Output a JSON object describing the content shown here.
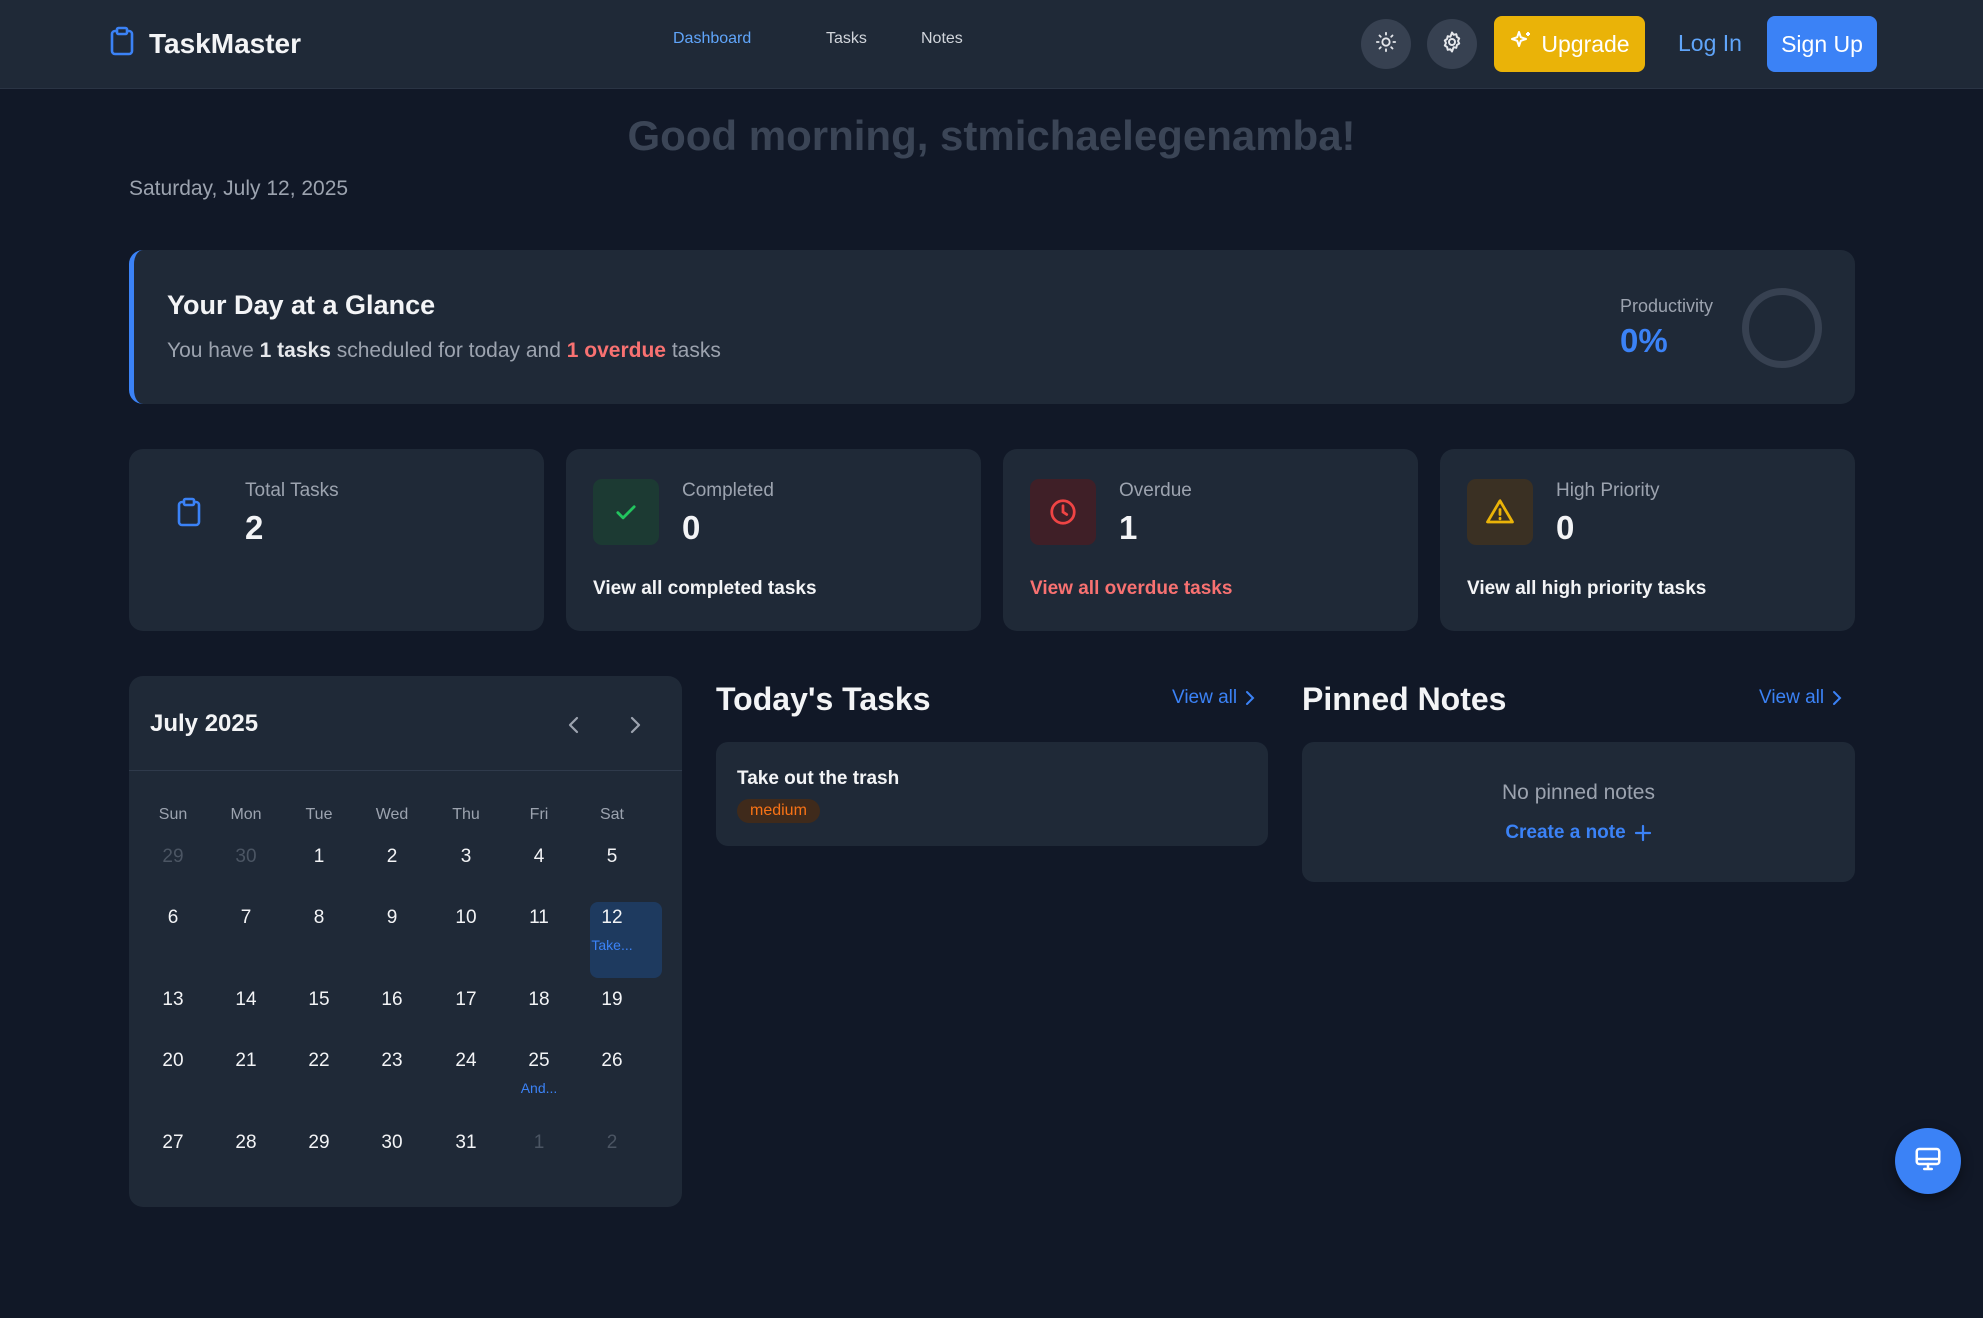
{
  "header": {
    "brand": "TaskMaster",
    "nav": [
      {
        "label": "Dashboard",
        "active": true
      },
      {
        "label": "Tasks",
        "active": false
      },
      {
        "label": "Notes",
        "active": false
      }
    ],
    "upgrade_label": "Upgrade",
    "login_label": "Log In",
    "signup_label": "Sign Up"
  },
  "greeting": "Good morning, stmichaelegenamba!",
  "date": "Saturday, July 12, 2025",
  "glance": {
    "title": "Your Day at a Glance",
    "text_prefix": "You have",
    "tasks_count": "1 tasks",
    "text_mid": "scheduled for today and",
    "overdue_count": "1 overdue",
    "text_suffix": "tasks",
    "productivity_label": "Productivity",
    "productivity_value": "0%",
    "productivity_fraction": 0
  },
  "stats": [
    {
      "label": "Total Tasks",
      "value": "2",
      "link": "",
      "icon": "clipboard-icon"
    },
    {
      "label": "Completed",
      "value": "0",
      "link": "View all completed tasks",
      "icon": "check-icon"
    },
    {
      "label": "Overdue",
      "value": "1",
      "link": "View all overdue tasks",
      "icon": "clock-icon"
    },
    {
      "label": "High Priority",
      "value": "0",
      "link": "View all high priority tasks",
      "icon": "warning-icon"
    }
  ],
  "calendar": {
    "title": "July 2025",
    "weekdays": [
      "Sun",
      "Mon",
      "Tue",
      "Wed",
      "Thu",
      "Fri",
      "Sat"
    ],
    "weeks": [
      [
        "29",
        "30",
        "1",
        "2",
        "3",
        "4",
        "5"
      ],
      [
        "6",
        "7",
        "8",
        "9",
        "10",
        "11",
        "12"
      ],
      [
        "13",
        "14",
        "15",
        "16",
        "17",
        "18",
        "19"
      ],
      [
        "20",
        "21",
        "22",
        "23",
        "24",
        "25",
        "26"
      ],
      [
        "27",
        "28",
        "29",
        "30",
        "31",
        "1",
        "2"
      ]
    ],
    "events": [
      {
        "week": 1,
        "day": 6,
        "label": "Take..."
      },
      {
        "week": 3,
        "day": 5,
        "label": "And..."
      }
    ]
  },
  "todays_tasks": {
    "title": "Today's Tasks",
    "view_all": "View all",
    "items": [
      {
        "title": "Take out the trash",
        "priority": "medium"
      }
    ]
  },
  "pinned_notes": {
    "title": "Pinned Notes",
    "view_all": "View all",
    "empty_text": "No pinned notes",
    "create_label": "Create a note"
  },
  "colors": {
    "accent": "#3b82f6",
    "danger": "#f87171",
    "warning": "#eab308",
    "success": "#22c55e",
    "background": "#111827",
    "card": "#1f2937"
  }
}
